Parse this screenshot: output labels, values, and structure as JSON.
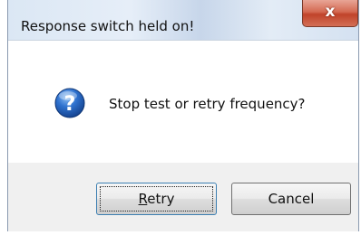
{
  "dialog": {
    "title": "Response switch held on!",
    "close_glyph": "x",
    "message": "Stop test or retry frequency?",
    "icon": "question-icon",
    "icon_color": "#1f5fb5"
  },
  "buttons": {
    "retry_mnemonic": "R",
    "retry_rest": "etry",
    "cancel_label": "Cancel"
  }
}
